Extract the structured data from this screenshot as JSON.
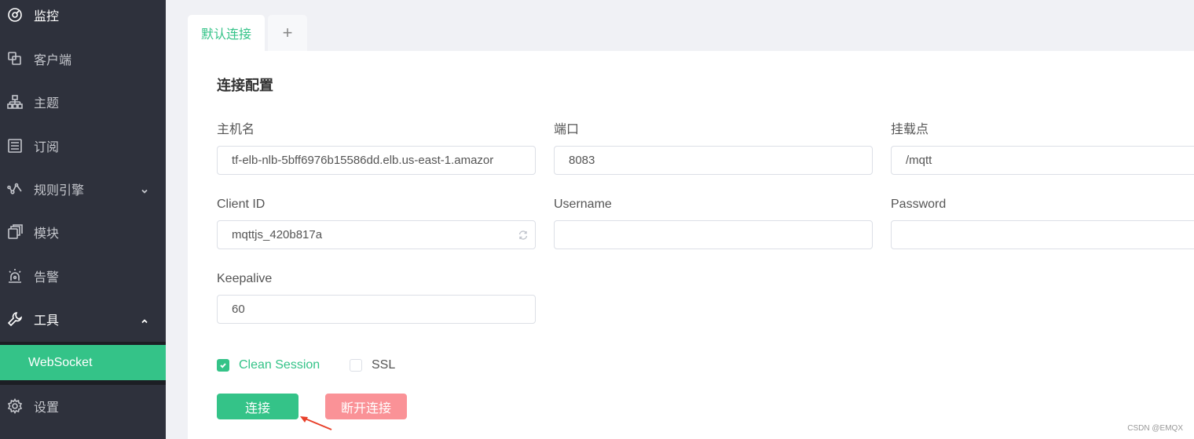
{
  "sidebar": {
    "items": [
      {
        "label": "监控",
        "icon": "dashboard-icon"
      },
      {
        "label": "客户端",
        "icon": "clients-icon"
      },
      {
        "label": "主题",
        "icon": "topics-icon"
      },
      {
        "label": "订阅",
        "icon": "subscriptions-icon"
      },
      {
        "label": "规则引擎",
        "icon": "rule-engine-icon",
        "expandable": true,
        "expanded": false
      },
      {
        "label": "模块",
        "icon": "modules-icon"
      },
      {
        "label": "告警",
        "icon": "alarm-icon"
      },
      {
        "label": "工具",
        "icon": "wrench-icon",
        "expandable": true,
        "expanded": true
      },
      {
        "label": "设置",
        "icon": "gear-icon"
      }
    ],
    "submenu_active": "WebSocket"
  },
  "tabs": {
    "active": "默认连接",
    "add_label": "+"
  },
  "form": {
    "title": "连接配置",
    "host": {
      "label": "主机名",
      "value": "tf-elb-nlb-5bff6976b15586dd.elb.us-east-1.amazor"
    },
    "port": {
      "label": "端口",
      "value": "8083"
    },
    "path": {
      "label": "挂载点",
      "value": "/mqtt"
    },
    "client_id": {
      "label": "Client ID",
      "value": "mqttjs_420b817a"
    },
    "username": {
      "label": "Username",
      "value": ""
    },
    "password": {
      "label": "Password",
      "value": ""
    },
    "keepalive": {
      "label": "Keepalive",
      "value": "60"
    },
    "clean_session": {
      "label": "Clean Session",
      "checked": true
    },
    "ssl": {
      "label": "SSL",
      "checked": false
    },
    "connect_label": "连接",
    "disconnect_label": "断开连接"
  },
  "colors": {
    "accent": "#34c388",
    "danger": "#fa9297",
    "sidebar_bg": "#2e313c"
  },
  "watermark": "CSDN @EMQX"
}
